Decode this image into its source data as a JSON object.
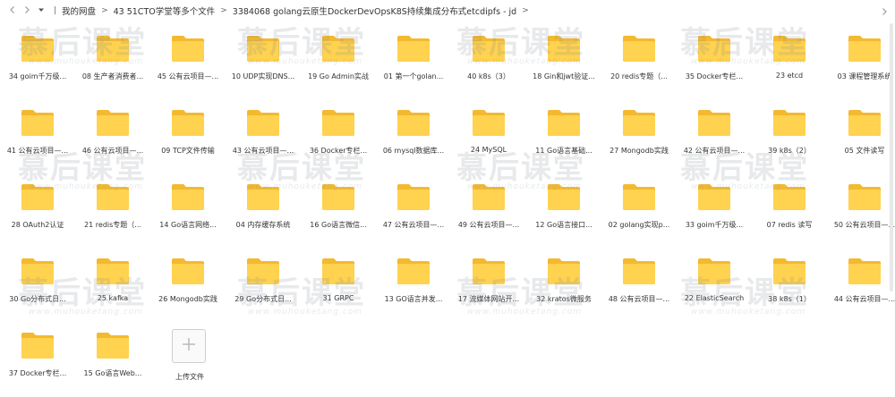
{
  "nav": {
    "breadcrumbs": [
      "我的网盘",
      "43 51CTO学堂等多个文件",
      "3384068 golang云原生DockerDevOpsK8S持续集成分布式etcdipfs - jd"
    ]
  },
  "items": [
    "34 goim千万级...",
    "08 生产者消费者...",
    "45 公有云项目—...",
    "10 UDP实现DNS...",
    "19 Go Admin实战",
    "01 第一个golan...",
    "40 k8s（3）",
    "18 Gin和jwt验证...",
    "20 redis专题（...",
    "35 Docker专栏...",
    "23 etcd",
    "03 课程管理系统",
    "41 公有云项目—...",
    "46 公有云项目—...",
    "09 TCP文件传输",
    "43 公有云项目—...",
    "36 Docker专栏...",
    "06 mysql数据库...",
    "24 MySQL",
    "11 Go语言基础...",
    "27 Mongodb实践",
    "42 公有云项目—...",
    "39 k8s（2）",
    "05 文件读写",
    "28 OAuth2认证",
    "21 redis专题（...",
    "14 Go语言网络...",
    "04 内存缓存系统",
    "16 Go语言微信...",
    "47 公有云项目—...",
    "49 公有云项目—...",
    "12 Go语言接口...",
    "02 golang实现p...",
    "33 goim千万级...",
    "07 redis 读写",
    "50 公有云项目—...",
    "30 Go分布式日...",
    "25 kafka",
    "26 Mongodb实践",
    "29 Go分布式日...",
    "31 GRPC",
    "13 GO语言并发...",
    "17 流媒体网站开...",
    "32 kratos微服务",
    "48 公有云项目—...",
    "22 ElasticSearch",
    "38 k8s（1）",
    "44 公有云项目—...",
    "37 Docker专栏...",
    "15 Go语言Web..."
  ],
  "upload_label": "上传文件",
  "watermark": {
    "big": "慕后课堂",
    "small": "www.muhouketang.com"
  },
  "colors": {
    "folder_front": "#FFD24F",
    "folder_back": "#F3B92F"
  },
  "icons": {
    "back": "chevron-left-icon",
    "forward": "chevron-right-icon",
    "upload": "plus-icon",
    "folder": "folder-icon"
  }
}
